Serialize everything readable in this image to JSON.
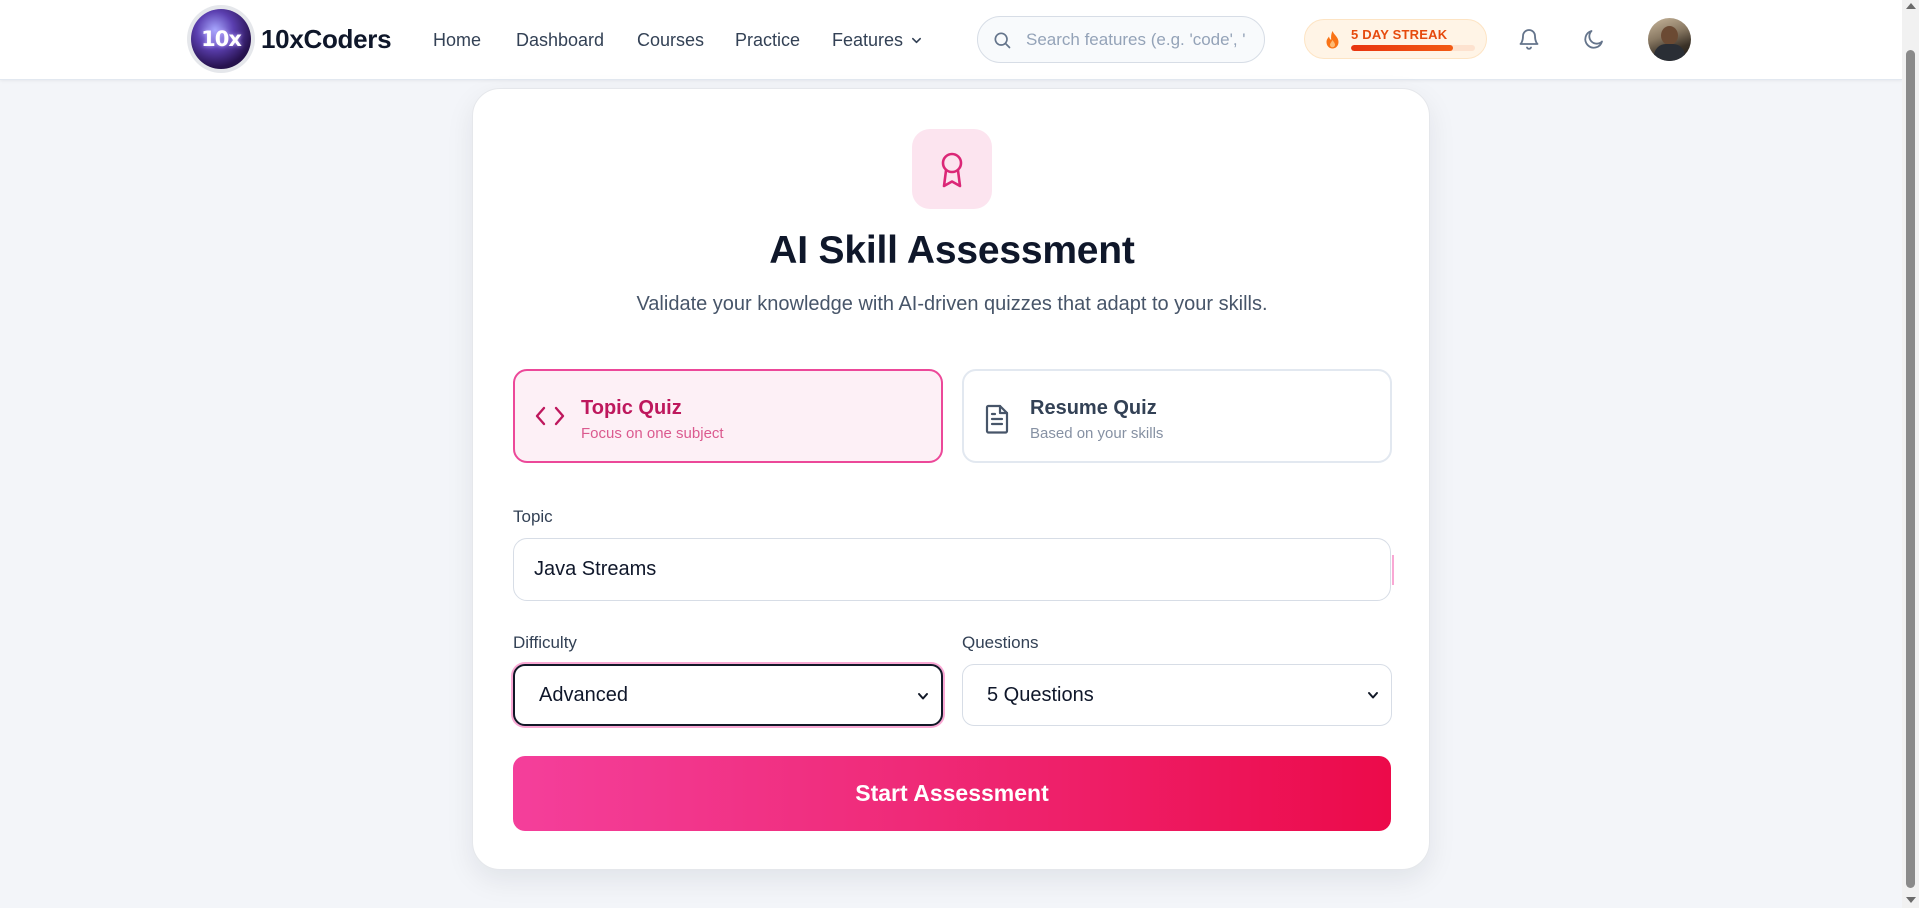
{
  "header": {
    "logo_text": "10x",
    "brand": "10xCoders",
    "nav": [
      "Home",
      "Dashboard",
      "Courses",
      "Practice",
      "Features"
    ],
    "search_placeholder": "Search features (e.g. 'code', '",
    "streak": {
      "label": "5 DAY STREAK",
      "progress_percent": 82
    }
  },
  "card": {
    "icon": "award-icon",
    "title": "AI Skill Assessment",
    "subtitle": "Validate your knowledge with AI-driven quizzes that adapt to your skills.",
    "modes": [
      {
        "title": "Topic Quiz",
        "description": "Focus on one subject",
        "icon": "code-icon",
        "selected": true
      },
      {
        "title": "Resume Quiz",
        "description": "Based on your skills",
        "icon": "document-icon",
        "selected": false
      }
    ],
    "topic": {
      "label": "Topic",
      "value": "Java Streams"
    },
    "difficulty": {
      "label": "Difficulty",
      "value": "Advanced"
    },
    "questions": {
      "label": "Questions",
      "value": "5 Questions"
    },
    "start_button": "Start Assessment"
  },
  "colors": {
    "accent": "#ec4899",
    "accent_dark": "#be185d",
    "button_gradient_start": "#f43f9b",
    "button_gradient_end": "#ec0a4a",
    "streak_text": "#e64a0d"
  }
}
